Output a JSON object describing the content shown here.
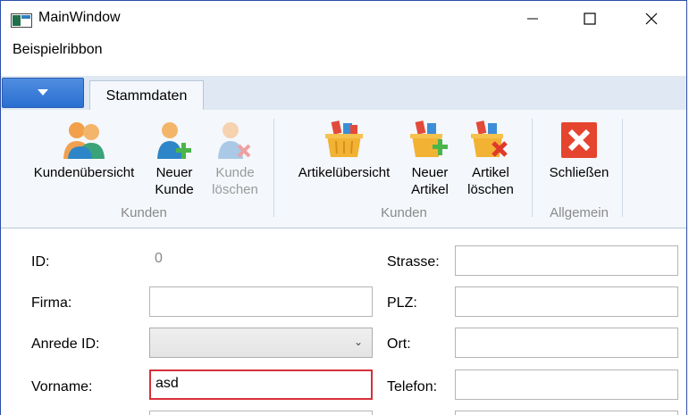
{
  "window": {
    "title": "MainWindow",
    "minimize_symbol": "—",
    "close_symbol": "✕"
  },
  "menu": {
    "label": "Beispielribbon"
  },
  "ribbon": {
    "tabs": [
      "Stammdaten"
    ],
    "groups": [
      {
        "label": "Kunden",
        "buttons": [
          {
            "label": "Kundenübersicht",
            "icon": "customers-icon",
            "enabled": true
          },
          {
            "label_line1": "Neuer",
            "label_line2": "Kunde",
            "icon": "add-customer-icon",
            "enabled": true
          },
          {
            "label_line1": "Kunde",
            "label_line2": "löschen",
            "icon": "delete-customer-icon",
            "enabled": false
          }
        ]
      },
      {
        "label": "Kunden",
        "buttons": [
          {
            "label": "Artikelübersicht",
            "icon": "basket-icon",
            "enabled": true
          },
          {
            "label_line1": "Neuer",
            "label_line2": "Artikel",
            "icon": "add-article-icon",
            "enabled": true
          },
          {
            "label_line1": "Artikel",
            "label_line2": "löschen",
            "icon": "delete-article-icon",
            "enabled": true
          }
        ]
      },
      {
        "label": "Allgemein",
        "buttons": [
          {
            "label": "Schließen",
            "icon": "close-red-icon",
            "enabled": true
          }
        ]
      }
    ]
  },
  "form": {
    "left": [
      {
        "label": "ID:",
        "value": "0"
      },
      {
        "label": "Firma:",
        "value": ""
      },
      {
        "label": "Anrede ID:",
        "value": ""
      },
      {
        "label": "Vorname:",
        "value": "asd"
      }
    ],
    "right": [
      {
        "label": "Strasse:",
        "value": ""
      },
      {
        "label": "PLZ:",
        "value": ""
      },
      {
        "label": "Ort:",
        "value": ""
      },
      {
        "label": "Telefon:",
        "value": ""
      }
    ]
  },
  "colors": {
    "focus_border": "#d6303a",
    "ribbon_bg": "#f4f7fb",
    "app_menu": "#2a6fd1"
  }
}
